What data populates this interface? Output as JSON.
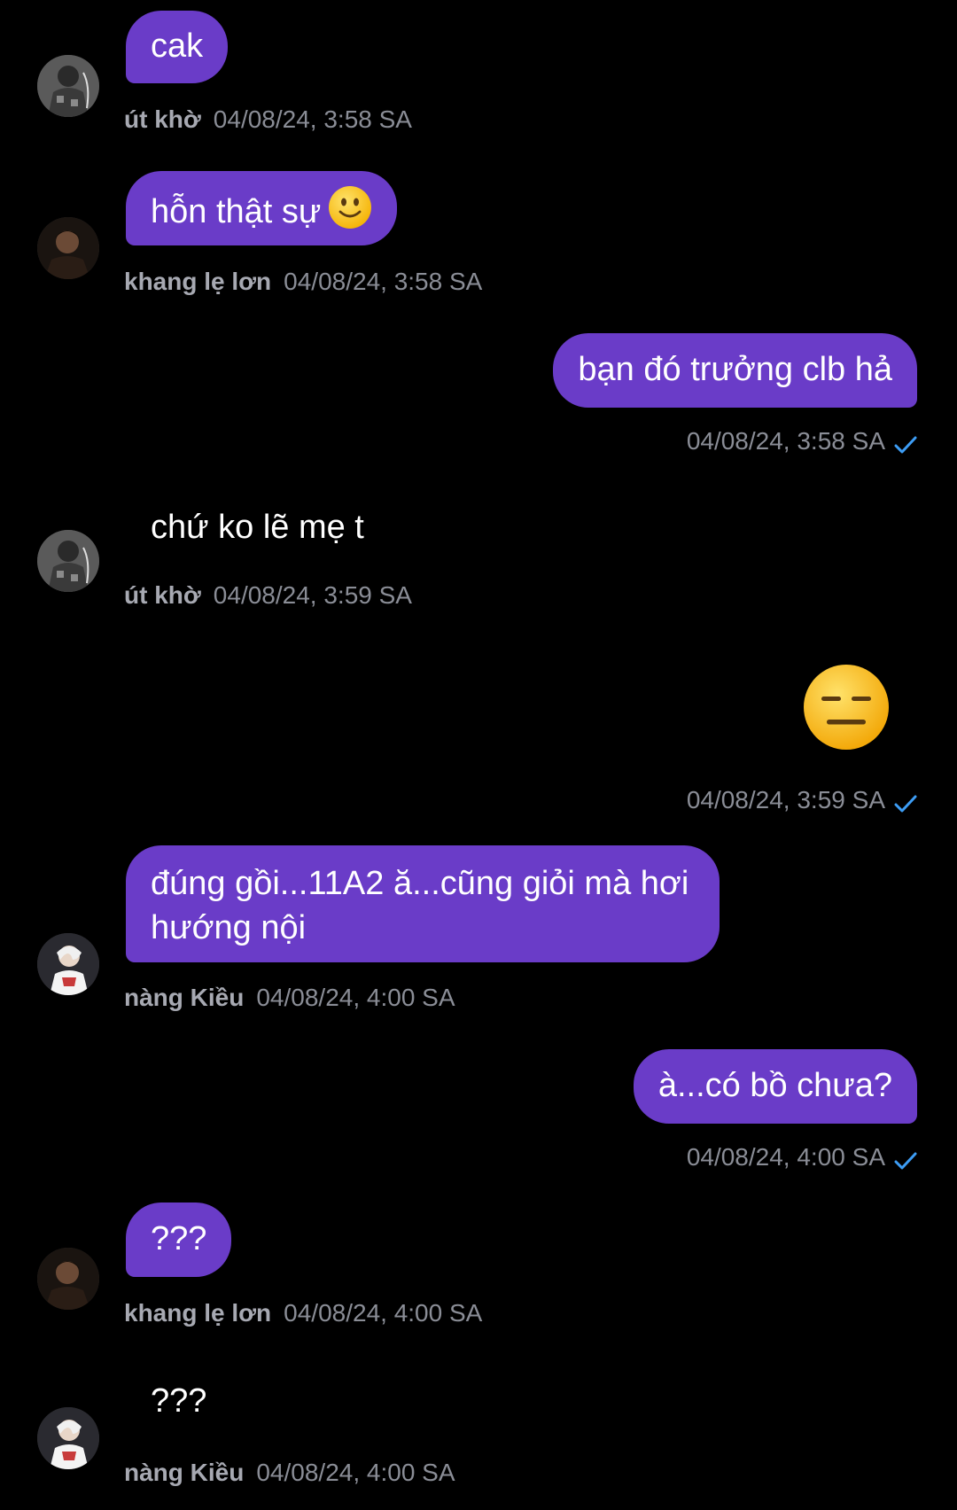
{
  "colors": {
    "background": "#000000",
    "bubble": "#6a3cc8",
    "sender_name": "#a7a9b2",
    "timestamp": "#8a8d96",
    "read_check": "#3d9df5"
  },
  "messages": [
    {
      "id": "m1",
      "direction": "in",
      "sender": "út khờ",
      "text": "cak",
      "time": "04/08/24, 3:58 SA",
      "avatar": "avatar-ut-kho"
    },
    {
      "id": "m2",
      "direction": "in",
      "sender": "khang lẹ lơn",
      "text": "hỗn thật sự",
      "emoji": "slightly-smiling-face-emoji",
      "time": "04/08/24, 3:58 SA",
      "avatar": "avatar-khang"
    },
    {
      "id": "m3",
      "direction": "out",
      "text": "bạn đó trưởng clb hả",
      "time": "04/08/24, 3:58 SA",
      "status_icon": "check-icon"
    },
    {
      "id": "m4",
      "direction": "in",
      "sender": "út khờ",
      "text": "chứ ko lẽ mẹ t",
      "time": "04/08/24, 3:59 SA",
      "avatar": "avatar-ut-kho",
      "style": "plain"
    },
    {
      "id": "m5",
      "direction": "out",
      "emoji": "expressionless-face-emoji",
      "time": "04/08/24, 3:59 SA",
      "status_icon": "check-icon"
    },
    {
      "id": "m6",
      "direction": "in",
      "sender": "nàng Kiều",
      "text": "đúng gồi...11A2 ă...cũng giỏi mà hơi hướng nội",
      "time": "04/08/24, 4:00 SA",
      "avatar": "avatar-nang-kieu"
    },
    {
      "id": "m7",
      "direction": "out",
      "text": "à...có bồ chưa?",
      "time": "04/08/24, 4:00 SA",
      "status_icon": "check-icon"
    },
    {
      "id": "m8",
      "direction": "in",
      "sender": "khang lẹ lơn",
      "text": "???",
      "time": "04/08/24, 4:00 SA",
      "avatar": "avatar-khang"
    },
    {
      "id": "m9",
      "direction": "in",
      "sender": "nàng Kiều",
      "text": "???",
      "time": "04/08/24, 4:00 SA",
      "avatar": "avatar-nang-kieu",
      "style": "plain"
    }
  ]
}
